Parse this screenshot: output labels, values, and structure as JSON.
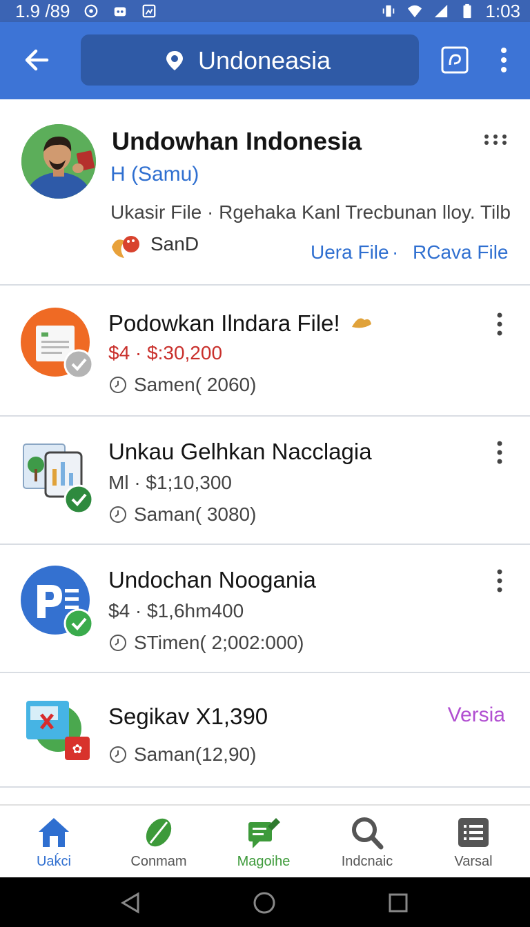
{
  "status_bar": {
    "left_text": "1.9 /89",
    "time": "1:03"
  },
  "app_bar": {
    "title": "Undoneasia"
  },
  "header": {
    "title": "Undowhan Indonesia",
    "subtitle": "H (Samu)",
    "info_line": "Ukasir File · Rgehaka Kanl Trecbunan lloy. Tilb",
    "tag": "SanD",
    "link1": "Uera File",
    "link_sep": "·",
    "link2": "RCava File"
  },
  "items": [
    {
      "title": "Podowkan Ilndara File!",
      "price": "$4 · $:30,200",
      "meta": "Samen( 2060)",
      "icon": "document-icon"
    },
    {
      "title": "Unkau Gelhkan Nacclagia",
      "price": "Ml · $1;10,300",
      "meta": "Saman( 3080)",
      "icon": "tablet-chart-icon"
    },
    {
      "title": "Undochan Noogania",
      "price": "$4 · $1,6hm400",
      "meta": "STimen(  2;002:000)",
      "icon": "p-doc-icon"
    },
    {
      "title": "Segikav X1,390",
      "meta": "Saman(12,90)",
      "link": "Versia",
      "icon": "slides-icon"
    }
  ],
  "bottom_nav": [
    {
      "label": "Uaḱci",
      "icon": "home-icon"
    },
    {
      "label": "Conmam",
      "icon": "leaf-icon"
    },
    {
      "label": "Magoihe",
      "icon": "message-edit-icon"
    },
    {
      "label": "Indcnaic",
      "icon": "search-icon"
    },
    {
      "label": "Varsal",
      "icon": "list-icon"
    }
  ],
  "colors": {
    "app_bar": "#3d74d6",
    "accent_blue": "#2f6fd0",
    "price_red": "#c9302c",
    "link_purple": "#b14fd1"
  }
}
